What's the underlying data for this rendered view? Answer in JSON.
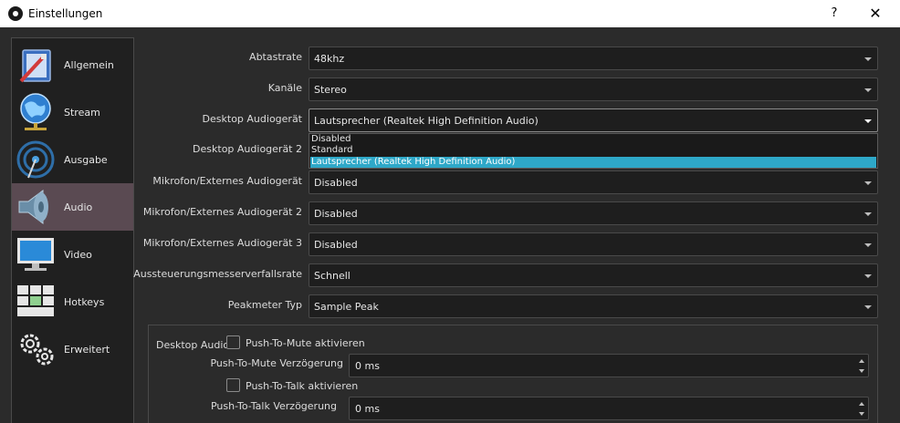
{
  "window": {
    "title": "Einstellungen",
    "help_label": "?",
    "close_label": "✕"
  },
  "sidebar": {
    "items": [
      {
        "label": "Allgemein",
        "icon": "general-settings-icon"
      },
      {
        "label": "Stream",
        "icon": "globe-stream-icon"
      },
      {
        "label": "Ausgabe",
        "icon": "broadcast-output-icon"
      },
      {
        "label": "Audio",
        "icon": "speaker-icon",
        "active": true
      },
      {
        "label": "Video",
        "icon": "monitor-icon"
      },
      {
        "label": "Hotkeys",
        "icon": "keyboard-icon"
      },
      {
        "label": "Erweitert",
        "icon": "gears-icon"
      }
    ]
  },
  "form": {
    "rows": [
      {
        "label": "Abtastrate",
        "value": "48khz"
      },
      {
        "label": "Kanäle",
        "value": "Stereo"
      },
      {
        "label": "Desktop Audiogerät",
        "value": "Lautsprecher (Realtek High Definition Audio)"
      },
      {
        "label": "Desktop Audiogerät 2",
        "value": ""
      },
      {
        "label": "Mikrofon/Externes Audiogerät",
        "value": "Disabled"
      },
      {
        "label": "Mikrofon/Externes Audiogerät 2",
        "value": "Disabled"
      },
      {
        "label": "Mikrofon/Externes Audiogerät 3",
        "value": "Disabled"
      },
      {
        "label": "Aussteuerungsmesserverfallsrate",
        "value": "Schnell"
      },
      {
        "label": "Peakmeter Typ",
        "value": "Sample Peak"
      }
    ]
  },
  "dropdown": {
    "options": [
      "Disabled",
      "Standard",
      "Lautsprecher (Realtek High Definition Audio)"
    ],
    "selected_index": 2
  },
  "desktop_audio_group": {
    "title": "Desktop Audio",
    "push_to_mute_label": "Push-To-Mute aktivieren",
    "push_to_mute_delay_label": "Push-To-Mute Verzögerung",
    "push_to_mute_delay_value": "0 ms",
    "push_to_talk_label": "Push-To-Talk aktivieren",
    "push_to_talk_delay_label": "Push-To-Talk Verzögerung",
    "push_to_talk_delay_value": "0 ms"
  },
  "colors": {
    "background": "#2b2b2b",
    "sidebar_active": "#5a4a52",
    "selection": "#2ea8c8"
  }
}
